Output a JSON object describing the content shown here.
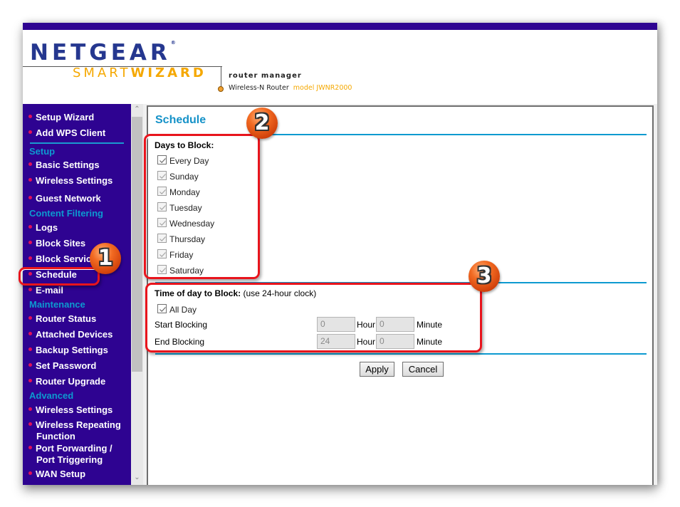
{
  "header": {
    "brand": "NETGEAR",
    "product_light": "SMART",
    "product_bold": "WIZARD",
    "subtitle": "router manager",
    "device": "Wireless-N Router",
    "model": "model JWNR2000"
  },
  "sidebar": {
    "items": [
      {
        "label": "Setup Wizard"
      },
      {
        "label": "Add WPS Client"
      },
      {
        "section": "Setup"
      },
      {
        "label": "Basic Settings"
      },
      {
        "label": "Wireless Settings"
      },
      {
        "label": "Guest Network"
      },
      {
        "section": "Content Filtering"
      },
      {
        "label": "Logs"
      },
      {
        "label": "Block Sites"
      },
      {
        "label": "Block Services"
      },
      {
        "label": "Schedule",
        "selected": true
      },
      {
        "label": "E-mail"
      },
      {
        "section": "Maintenance"
      },
      {
        "label": "Router Status"
      },
      {
        "label": "Attached Devices"
      },
      {
        "label": "Backup Settings"
      },
      {
        "label": "Set Password"
      },
      {
        "label": "Router Upgrade"
      },
      {
        "section": "Advanced"
      },
      {
        "label": "Wireless Settings"
      },
      {
        "label": "Wireless Repeating",
        "label2": "Function"
      },
      {
        "label": "Port Forwarding /",
        "label2": "Port Triggering"
      },
      {
        "label": "WAN Setup"
      }
    ]
  },
  "main": {
    "title": "Schedule",
    "days_title": "Days to Block:",
    "days": [
      {
        "label": "Every Day",
        "checked": true,
        "enabled": true
      },
      {
        "label": "Sunday",
        "checked": true,
        "enabled": false
      },
      {
        "label": "Monday",
        "checked": true,
        "enabled": false
      },
      {
        "label": "Tuesday",
        "checked": true,
        "enabled": false
      },
      {
        "label": "Wednesday",
        "checked": true,
        "enabled": false
      },
      {
        "label": "Thursday",
        "checked": true,
        "enabled": false
      },
      {
        "label": "Friday",
        "checked": true,
        "enabled": false
      },
      {
        "label": "Saturday",
        "checked": true,
        "enabled": false
      }
    ],
    "time_title": "Time of day to Block:",
    "time_hint": "(use 24-hour clock)",
    "all_day": {
      "label": "All Day",
      "checked": true
    },
    "start": {
      "label": "Start Blocking",
      "hour": "0",
      "minute": "0"
    },
    "end": {
      "label": "End Blocking",
      "hour": "24",
      "minute": "0"
    },
    "hour_unit": "Hour",
    "minute_unit": "Minute",
    "apply_label": "Apply",
    "cancel_label": "Cancel"
  },
  "annotations": {
    "badge1": "1",
    "badge2": "2",
    "badge3": "3",
    "color": "#e8141c"
  }
}
